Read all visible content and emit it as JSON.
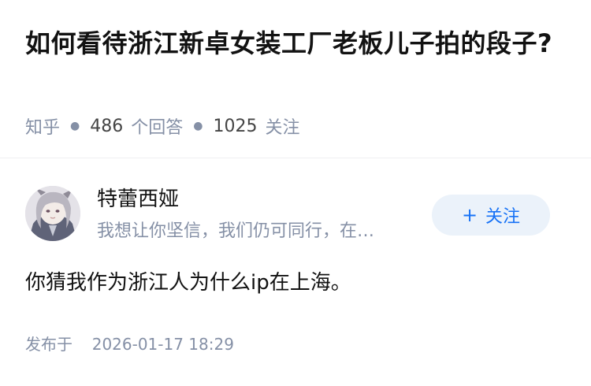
{
  "question": {
    "title": "如何看待浙江新卓女装工厂老板儿子拍的段子?",
    "source": "知乎",
    "answer_count": "486",
    "answer_count_label": "个回答",
    "follower_count": "1025",
    "follower_label": "关注"
  },
  "answer": {
    "author": {
      "name": "特蕾西娅",
      "headline": "我想让你坚信，我们仍可同行，在…",
      "avatar_icon": "anime-character-avatar"
    },
    "follow_button": {
      "icon": "+",
      "label": "关注"
    },
    "content": "你猜我作为浙江人为什么ip在上海。",
    "publish_prefix": "发布于",
    "publish_time": "2026-01-17 18:29"
  },
  "colors": {
    "title": "#121212",
    "meta": "#8590a6",
    "accent": "#1772f6",
    "follow_bg": "#ebf2fa"
  }
}
